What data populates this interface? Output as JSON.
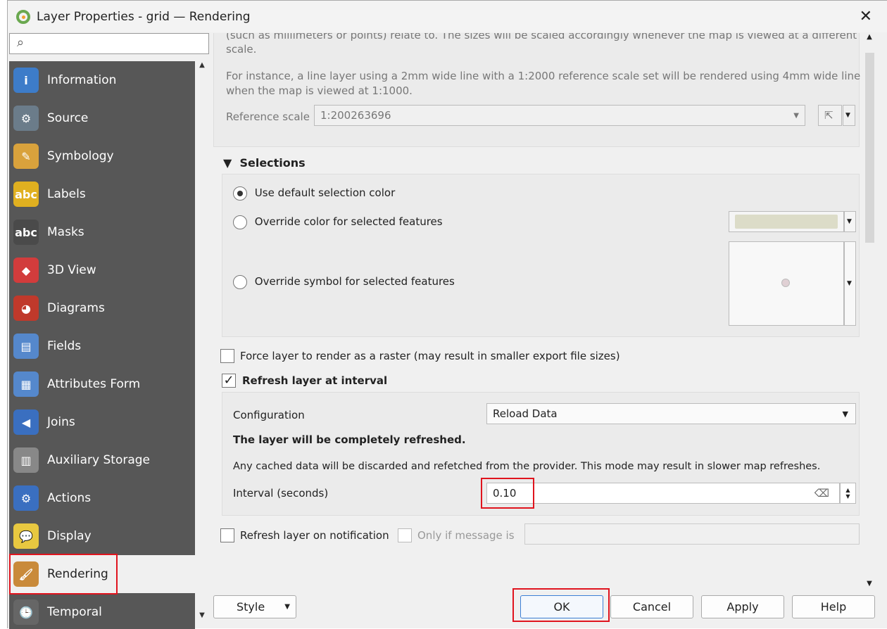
{
  "window": {
    "title": "Layer Properties - grid — Rendering",
    "close": "✕"
  },
  "search": {
    "placeholder": ""
  },
  "sidebar": {
    "items": [
      {
        "label": "Information",
        "icon": "i"
      },
      {
        "label": "Source",
        "icon": "⚙"
      },
      {
        "label": "Symbology",
        "icon": "✎"
      },
      {
        "label": "Labels",
        "icon": "abc"
      },
      {
        "label": "Masks",
        "icon": "abc"
      },
      {
        "label": "3D View",
        "icon": "◆"
      },
      {
        "label": "Diagrams",
        "icon": "◕"
      },
      {
        "label": "Fields",
        "icon": "▤"
      },
      {
        "label": "Attributes Form",
        "icon": "▦"
      },
      {
        "label": "Joins",
        "icon": "◀"
      },
      {
        "label": "Auxiliary Storage",
        "icon": "▥"
      },
      {
        "label": "Actions",
        "icon": "⚙"
      },
      {
        "label": "Display",
        "icon": "💬"
      },
      {
        "label": "Rendering",
        "icon": "🖌"
      },
      {
        "label": "Temporal",
        "icon": "🕒"
      }
    ],
    "active": "Rendering"
  },
  "scale": {
    "line0": "(such as millimeters or points) relate to. The sizes will be scaled accordingly whenever the map is viewed at a different",
    "line1": "scale.",
    "example1": "For instance, a line layer using a 2mm wide line with a 1:2000 reference scale set will be rendered using 4mm wide lines",
    "example2": "when the map is viewed at 1:1000.",
    "ref_label": "Reference scale",
    "ref_value": "1:200263696"
  },
  "selections": {
    "title": "Selections",
    "default": "Use default selection color",
    "override_color": "Override color for selected features",
    "override_symbol": "Override symbol for selected features",
    "selected": "default",
    "color": "#dcdcc8"
  },
  "raster": {
    "label": "Force layer to render as a raster (may result in smaller export file sizes)",
    "checked": false
  },
  "refresh": {
    "label": "Refresh layer at interval",
    "checked": true,
    "config_label": "Configuration",
    "config_value": "Reload Data",
    "bold_note": "The layer will be completely refreshed.",
    "note": "Any cached data will be discarded and refetched from the provider. This mode may result in slower map refreshes.",
    "interval_label": "Interval (seconds)",
    "interval_value": "0.10"
  },
  "notify": {
    "label": "Refresh layer on notification",
    "checked": false,
    "only_label": "Only if message is",
    "message": ""
  },
  "buttons": {
    "style": "Style",
    "ok": "OK",
    "cancel": "Cancel",
    "apply": "Apply",
    "help": "Help"
  }
}
